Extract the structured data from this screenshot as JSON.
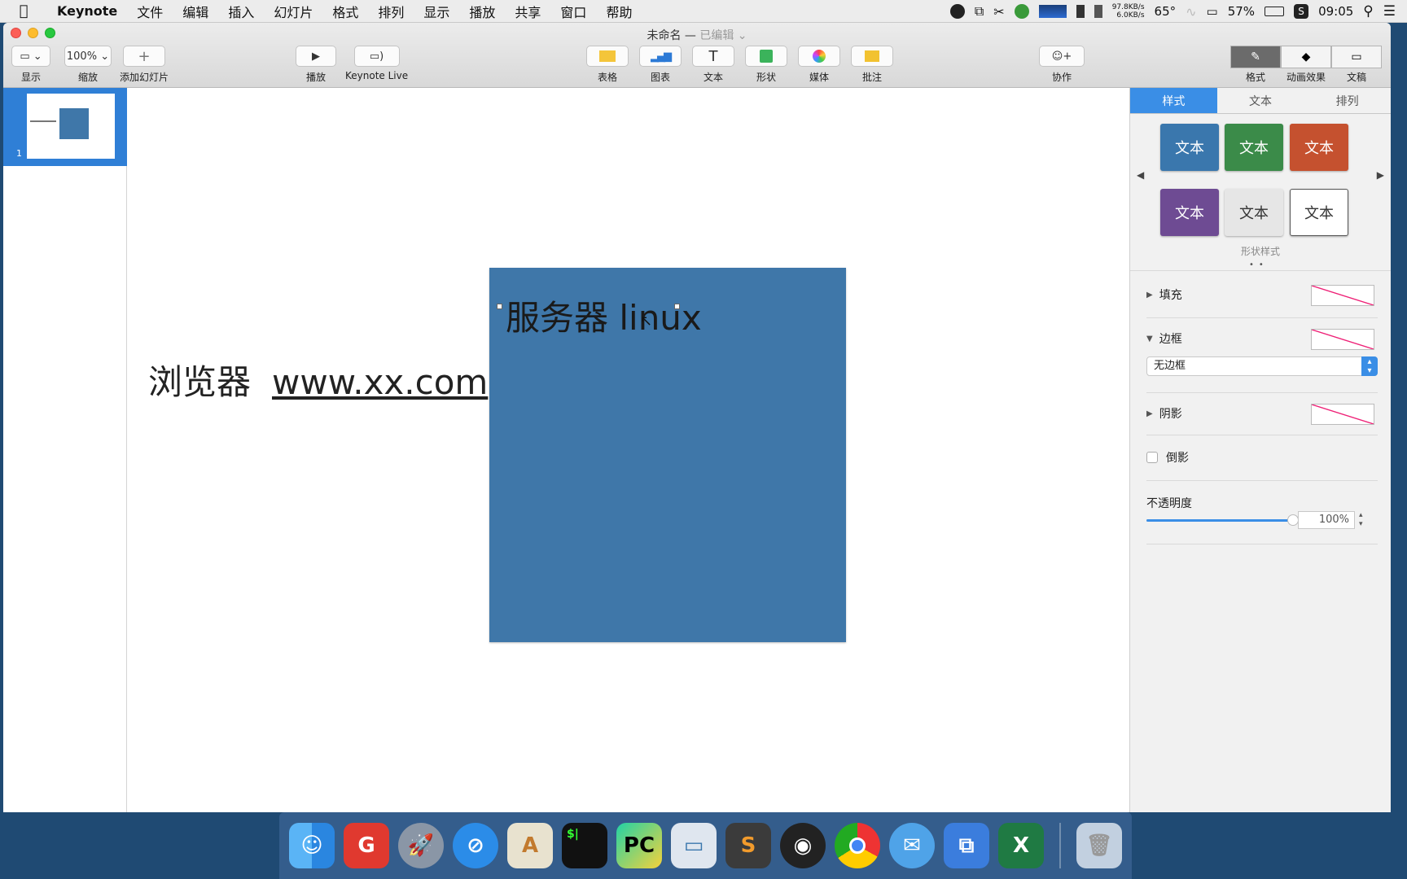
{
  "menubar": {
    "items": [
      "Keynote",
      "文件",
      "编辑",
      "插入",
      "幻灯片",
      "格式",
      "排列",
      "显示",
      "播放",
      "共享",
      "窗口",
      "帮助"
    ],
    "net_up": "97.8KB/s",
    "net_down": "6.0KB/s",
    "temperature": "65°",
    "battery": "57%",
    "clock": "09:05"
  },
  "window": {
    "title": "未命名",
    "title_sep": " — ",
    "title_status": "已编辑 ⌄"
  },
  "toolbar": {
    "view_label": "显示",
    "zoom_value": "100%",
    "zoom_label": "缩放",
    "add_slide_label": "添加幻灯片",
    "play_label": "播放",
    "live_label": "Keynote Live",
    "table_label": "表格",
    "chart_label": "图表",
    "text_label": "文本",
    "shape_label": "形状",
    "media_label": "媒体",
    "comment_label": "批注",
    "collab_label": "协作",
    "format_label": "格式",
    "animate_label": "动画效果",
    "document_label": "文稿"
  },
  "navigator": {
    "slide_number": "1"
  },
  "slide": {
    "browser_label": "浏览器",
    "browser_url": "www.xx.com",
    "server_text": "服务器 linux"
  },
  "inspector": {
    "tabs": [
      "样式",
      "文本",
      "排列"
    ],
    "swatch_text": "文本",
    "swatch_colors": [
      "#3a77ad",
      "#3b8b49",
      "#c5512f",
      "#6e4b93",
      "#e6e6e6",
      "#ffffff"
    ],
    "shape_styles_label": "形状样式",
    "fill_label": "填充",
    "border_label": "边框",
    "border_value": "无边框",
    "shadow_label": "阴影",
    "reflection_label": "倒影",
    "opacity_label": "不透明度",
    "opacity_value": "100%",
    "opacity_level": 1.0
  }
}
